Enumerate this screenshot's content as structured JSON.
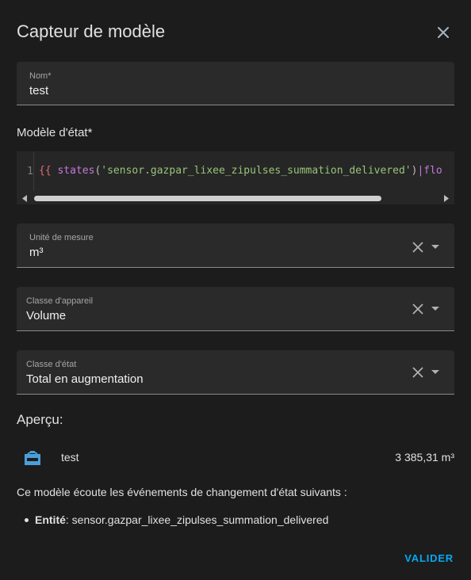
{
  "dialog": {
    "title": "Capteur de modèle"
  },
  "name_field": {
    "label": "Nom*",
    "value": "test"
  },
  "template_section": {
    "label": "Modèle d'état*",
    "line_number": "1",
    "code": {
      "open_brace": "{{",
      "fn": "states",
      "paren_open": "(",
      "string": "'sensor.gazpar_lixee_zipulses_summation_delivered'",
      "paren_close": ")",
      "pipe": "|",
      "rest": "flo"
    }
  },
  "unit_field": {
    "label": "Unité de mesure",
    "value": "m³"
  },
  "device_class_field": {
    "label": "Classe d'appareil",
    "value": "Volume"
  },
  "state_class_field": {
    "label": "Classe d'état",
    "value": "Total en augmentation"
  },
  "preview": {
    "heading": "Aperçu:",
    "icon": "meter-gas-icon",
    "name": "test",
    "value": "3 385,31 m³"
  },
  "listeners": {
    "text": "Ce modèle écoute les événements de changement d'état suivants :",
    "entity_label": "Entité",
    "entity_value": ": sensor.gazpar_lixee_zipulses_summation_delivered"
  },
  "actions": {
    "validate_label": "VALIDER"
  },
  "colors": {
    "background": "#1c1c1c",
    "field_bg": "#2a2a2a",
    "accent": "#03a9f4",
    "icon": "#4a9fd8"
  }
}
